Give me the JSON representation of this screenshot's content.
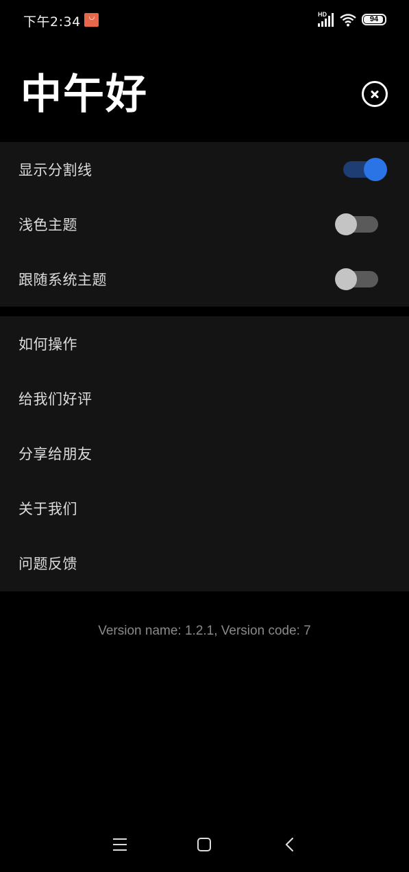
{
  "status_bar": {
    "time": "下午2:34",
    "network_label": "HD",
    "battery": "94",
    "battery_level_percent": 94
  },
  "header": {
    "greeting": "中午好"
  },
  "settings": [
    {
      "label": "显示分割线",
      "toggle_on": true
    },
    {
      "label": "浅色主题",
      "toggle_on": false
    },
    {
      "label": "跟随系统主题",
      "toggle_on": false
    }
  ],
  "links": [
    {
      "label": "如何操作"
    },
    {
      "label": "给我们好评"
    },
    {
      "label": "分享给朋友"
    },
    {
      "label": "关于我们"
    },
    {
      "label": "问题反馈"
    }
  ],
  "version_text": "Version name: 1.2.1, Version code: 7",
  "colors": {
    "background": "#000000",
    "card": "#141414",
    "accent": "#2b74e6",
    "toggle_track_on": "#1e3d73",
    "toggle_track_off": "#5a5a5a",
    "toggle_knob_off": "#c4c4c4"
  }
}
